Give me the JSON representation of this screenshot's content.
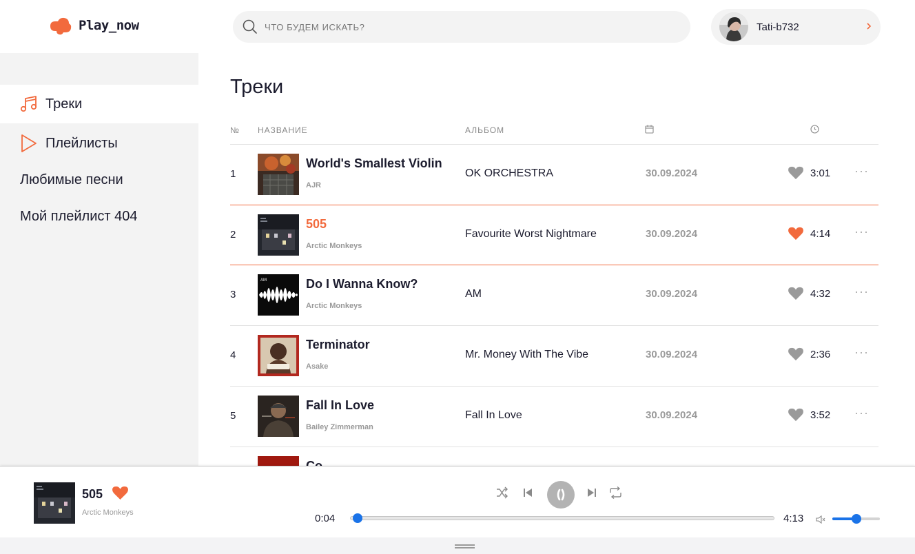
{
  "app": {
    "logo_text": "Play_now",
    "accent_color": "#f26a3d"
  },
  "search": {
    "placeholder": "ЧТО БУДЕМ ИСКАТЬ?",
    "value": ""
  },
  "user": {
    "name": "Tati-b732"
  },
  "sidebar": {
    "items": [
      {
        "label": "Треки",
        "icon": "music-note-icon",
        "active": true
      },
      {
        "label": "Плейлисты",
        "icon": "play-triangle-icon",
        "active": false
      },
      {
        "label": "Любимые песни",
        "active": false
      },
      {
        "label": "Мой плейлист 404",
        "active": false
      }
    ]
  },
  "main": {
    "title": "Треки",
    "columns": {
      "num": "№",
      "name": "НАЗВАНИЕ",
      "album": "АЛЬБОМ",
      "date_icon": "calendar-icon",
      "duration_icon": "clock-icon"
    },
    "tracks": [
      {
        "num": "1",
        "title": "World's Smallest Violin",
        "artist": "AJR",
        "album": "OK ORCHESTRA",
        "date": "30.09.2024",
        "liked": false,
        "duration": "3:01"
      },
      {
        "num": "2",
        "title": "505",
        "artist": "Arctic Monkeys",
        "album": "Favourite Worst Nightmare",
        "date": "30.09.2024",
        "liked": true,
        "duration": "4:14",
        "playing": true
      },
      {
        "num": "3",
        "title": "Do I Wanna Know?",
        "artist": "Arctic Monkeys",
        "album": "AM",
        "date": "30.09.2024",
        "liked": false,
        "duration": "4:32"
      },
      {
        "num": "4",
        "title": "Terminator",
        "artist": "Asake",
        "album": "Mr. Money With The Vibe",
        "date": "30.09.2024",
        "liked": false,
        "duration": "2:36"
      },
      {
        "num": "5",
        "title": "Fall In Love",
        "artist": "Bailey Zimmerman",
        "album": "Fall In Love",
        "date": "30.09.2024",
        "liked": false,
        "duration": "3:52"
      },
      {
        "num": "",
        "title": "Co",
        "artist": "",
        "album": "",
        "date": "",
        "liked": false,
        "duration": ""
      }
    ]
  },
  "player": {
    "title": "505",
    "artist": "Arctic Monkeys",
    "liked": true,
    "current_time": "0:04",
    "total_time": "4:13",
    "progress": 0.016,
    "volume": 0.5
  }
}
